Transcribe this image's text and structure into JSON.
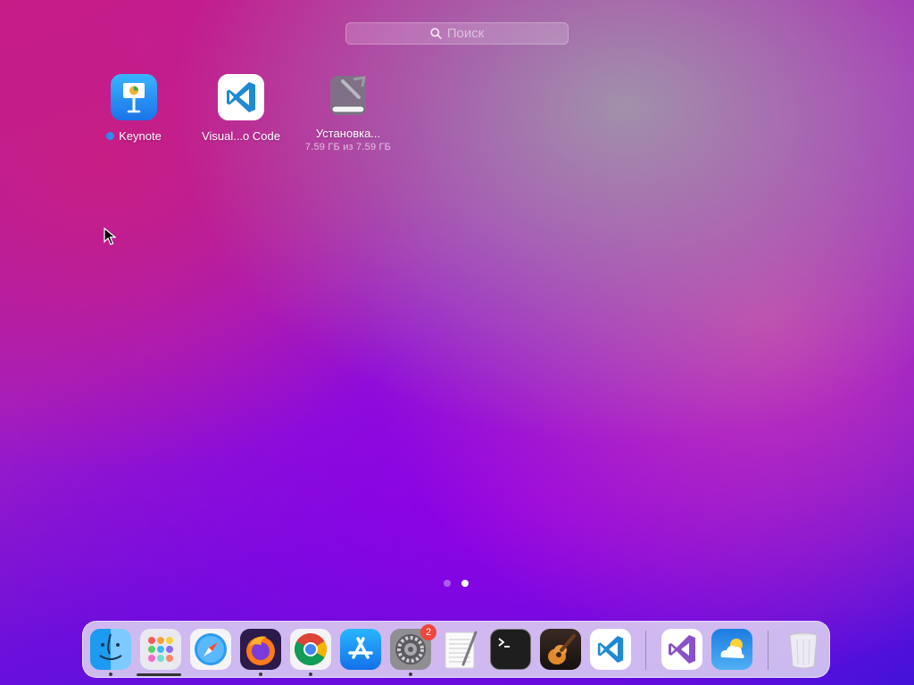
{
  "search": {
    "placeholder": "Поиск"
  },
  "apps": [
    {
      "name": "Keynote",
      "new": true
    },
    {
      "name": "Visual...o Code"
    },
    {
      "name": "Установка...",
      "progress_text": "7.59 ГБ из 7.59 ГБ"
    }
  ],
  "pager": {
    "pages": 2,
    "current": 2
  },
  "dock": {
    "items": [
      {
        "icon": "finder-icon",
        "running": true
      },
      {
        "icon": "launchpad-icon",
        "running": false,
        "active": true
      },
      {
        "icon": "safari-icon",
        "running": false
      },
      {
        "icon": "firefox-icon",
        "running": true
      },
      {
        "icon": "chrome-icon",
        "running": true
      },
      {
        "icon": "app-store-icon",
        "running": false
      },
      {
        "icon": "system-preferences-icon",
        "running": true,
        "badge": "2"
      },
      {
        "icon": "textedit-icon",
        "running": false
      },
      {
        "icon": "terminal-icon",
        "running": false
      },
      {
        "icon": "garageband-icon",
        "running": false
      },
      {
        "icon": "vscode-icon",
        "running": false
      },
      {
        "icon": "visual-studio-icon",
        "running": false
      },
      {
        "icon": "weather-icon",
        "running": false
      },
      {
        "icon": "trash-icon",
        "running": false
      }
    ]
  },
  "colors": {
    "badge": "#f0463c",
    "new_dot": "#2a8bf2"
  }
}
